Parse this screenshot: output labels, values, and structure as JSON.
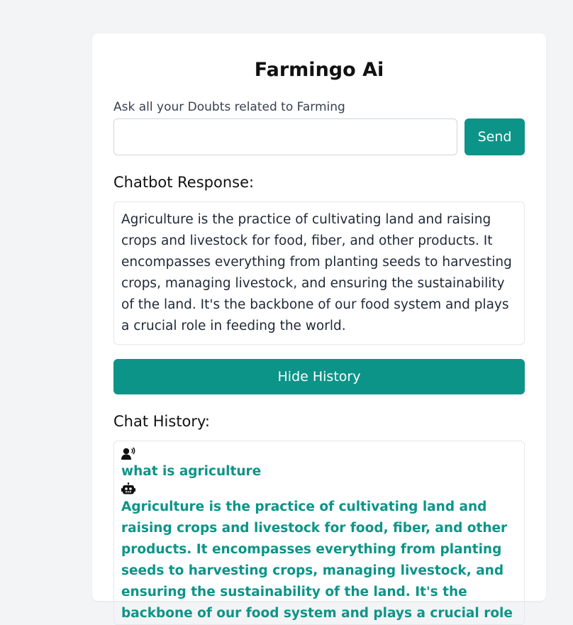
{
  "app": {
    "title": "Farmingo Ai"
  },
  "ask": {
    "label": "Ask all your Doubts related to Farming",
    "input_value": "",
    "send_label": "Send"
  },
  "response": {
    "heading": "Chatbot Response:",
    "text": "Agriculture is the practice of cultivating land and raising crops and livestock for food, fiber, and other products. It encompasses everything from planting seeds to harvesting crops, managing livestock, and ensuring the sustainability of the land. It's the backbone of our food system and plays a crucial role in feeding the world."
  },
  "history": {
    "toggle_label": "Hide History",
    "heading": "Chat History:",
    "entries": [
      {
        "user_icon": "user-voice-icon",
        "question": "what is agriculture",
        "bot_icon": "robot-icon",
        "answer": "Agriculture is the practice of cultivating land and raising crops and livestock for food, fiber, and other products. It encompasses everything from planting seeds to harvesting crops, managing livestock, and ensuring the sustainability of the land. It's the backbone of our food system and plays a crucial role in feeding the world."
      }
    ]
  },
  "colors": {
    "accent": "#0d9488",
    "background": "#f3f4f6",
    "card": "#ffffff"
  }
}
